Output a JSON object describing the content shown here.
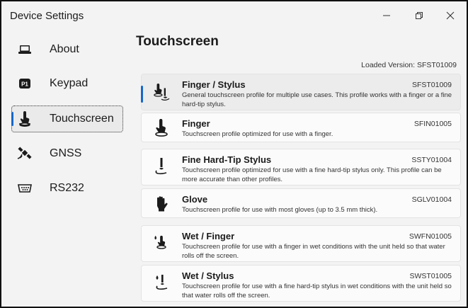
{
  "window": {
    "title": "Device Settings",
    "controls": {
      "minimize": "minimize",
      "maximize": "maximize",
      "close": "close"
    }
  },
  "sidebar": {
    "items": [
      {
        "label": "About",
        "icon": "laptop-icon",
        "selected": false
      },
      {
        "label": "Keypad",
        "icon": "keypad-p1-icon",
        "selected": false
      },
      {
        "label": "Touchscreen",
        "icon": "touch-finger-icon",
        "selected": true
      },
      {
        "label": "GNSS",
        "icon": "satellite-icon",
        "selected": false
      },
      {
        "label": "RS232",
        "icon": "serial-port-icon",
        "selected": false
      }
    ]
  },
  "main": {
    "title": "Touchscreen",
    "loaded_version": "Loaded Version: SFST01009",
    "profiles": [
      {
        "name": "Finger / Stylus",
        "code": "SFST01009",
        "description": "General touchscreen profile for multiple use cases. This profile works with a finger or a fine hard-tip stylus.",
        "icon": "finger-stylus-icon",
        "selected": true
      },
      {
        "name": "Finger",
        "code": "SFIN01005",
        "description": "Touchscreen profile optimized for use with a finger.",
        "icon": "finger-touch-icon",
        "selected": false
      },
      {
        "name": "Fine Hard-Tip Stylus",
        "code": "SSTY01004",
        "description": "Touchscreen profile optimized for use with a fine hard-tip stylus only. This profile can be more accurate than other profiles.",
        "icon": "stylus-icon",
        "selected": false
      },
      {
        "name": "Glove",
        "code": "SGLV01004",
        "description": "Touchscreen profile for use with most gloves (up to 3.5 mm thick).",
        "icon": "glove-icon",
        "selected": false
      },
      {
        "name": "Wet / Finger",
        "code": "SWFN01005",
        "description": "Touchscreen profile for use with a finger in wet conditions with the unit held so that water rolls off the screen.",
        "icon": "wet-finger-icon",
        "selected": false
      },
      {
        "name": "Wet / Stylus",
        "code": "SWST01005",
        "description": "Touchscreen profile for use with a fine hard-tip stylus in wet conditions with the unit held so that water rolls off the screen.",
        "icon": "wet-stylus-icon",
        "selected": false
      }
    ]
  },
  "colors": {
    "accent": "#1667c9",
    "background": "#f3f3f3",
    "card": "#fbfbfb",
    "card_selected": "#ececec"
  }
}
